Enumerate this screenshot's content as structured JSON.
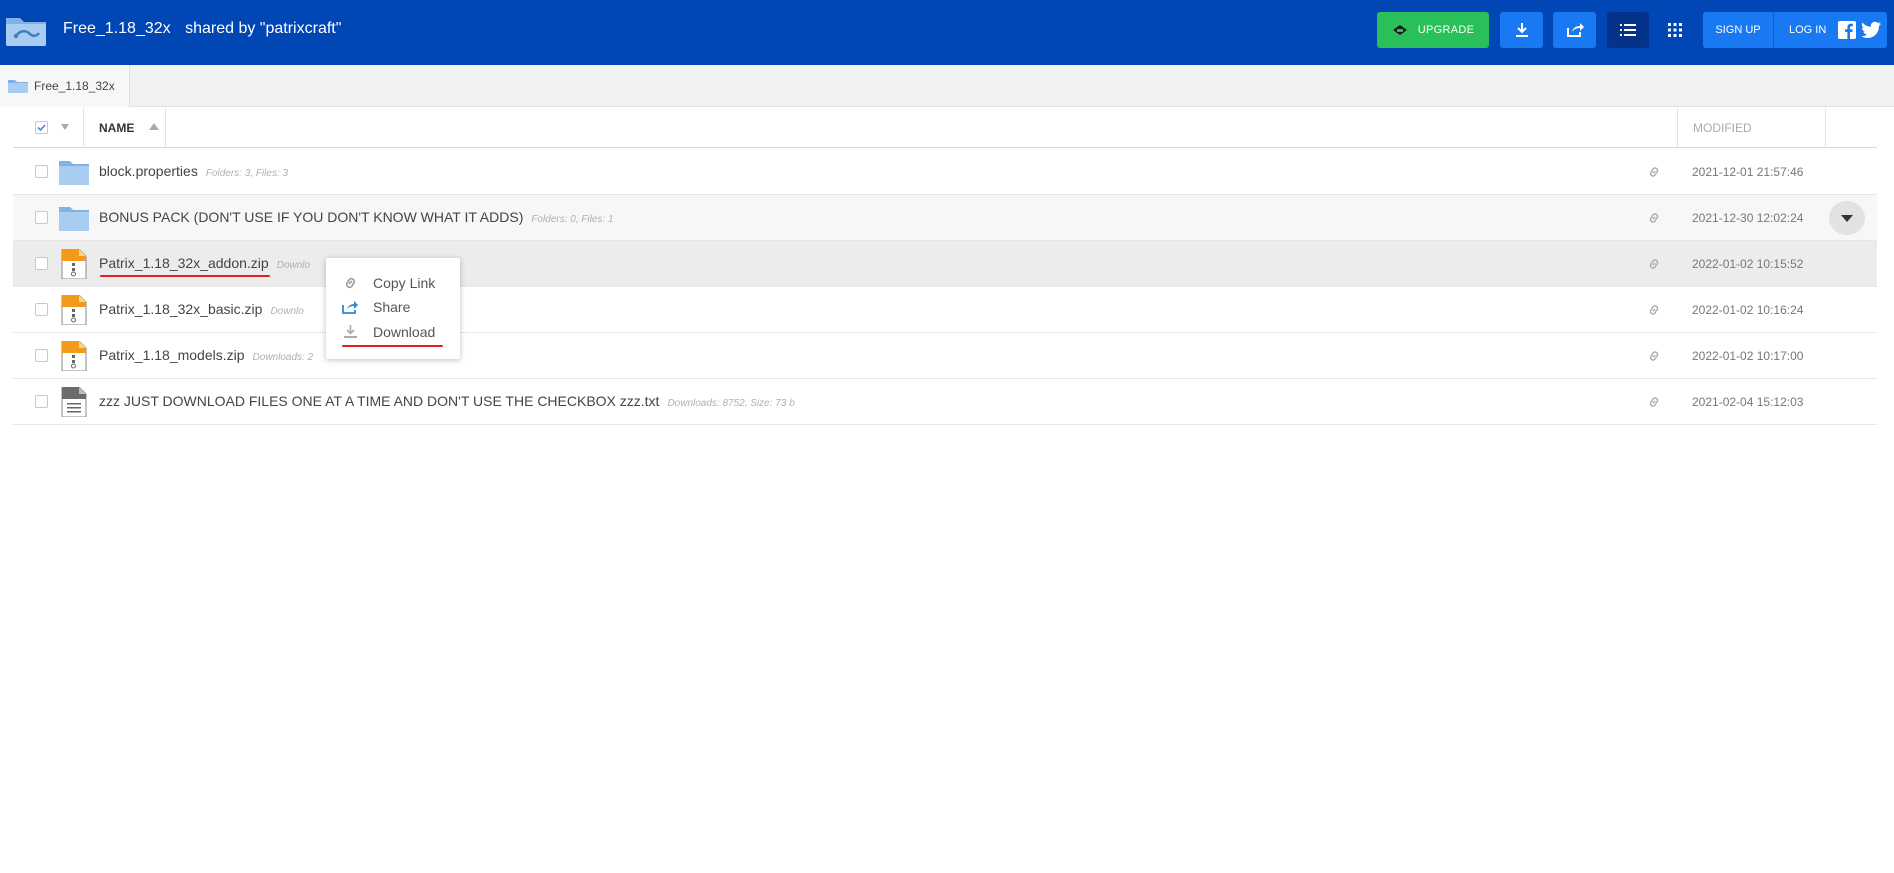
{
  "header": {
    "folder_name": "Free_1.18_32x",
    "shared_by": "shared by \"patrixcraft\"",
    "upgrade_label": "UPGRADE",
    "signup_label": "SIGN UP",
    "login_label": "LOG IN"
  },
  "breadcrumb": {
    "label": "Free_1.18_32x"
  },
  "table": {
    "col_name": "NAME",
    "col_modified": "MODIFIED",
    "rows": [
      {
        "name": "block.properties",
        "meta": "Folders: 3, Files: 3",
        "date": "2021-12-01 21:57:46"
      },
      {
        "name": "BONUS PACK (DON'T USE IF YOU DON'T KNOW WHAT IT ADDS)",
        "meta": "Folders: 0, Files: 1",
        "date": "2021-12-30 12:02:24"
      },
      {
        "name": "Patrix_1.18_32x_addon.zip",
        "meta": "Downlo",
        "date": "2022-01-02 10:15:52"
      },
      {
        "name": "Patrix_1.18_32x_basic.zip",
        "meta": "Downlo",
        "date": "2022-01-02 10:16:24"
      },
      {
        "name": "Patrix_1.18_models.zip",
        "meta": "Downloads: 2",
        "date": "2022-01-02 10:17:00"
      },
      {
        "name": "zzz JUST DOWNLOAD FILES ONE AT A TIME AND DON'T USE THE CHECKBOX zzz.txt",
        "meta": "Downloads: 8752, Size: 73 b",
        "date": "2021-02-04 15:12:03"
      }
    ]
  },
  "context_menu": {
    "copy_link": "Copy Link",
    "share": "Share",
    "download": "Download"
  },
  "colors": {
    "header_bg": "#0046b4",
    "upgrade_green": "#29c05a",
    "button_blue": "#1979f2",
    "annotation_red": "#e02020"
  }
}
